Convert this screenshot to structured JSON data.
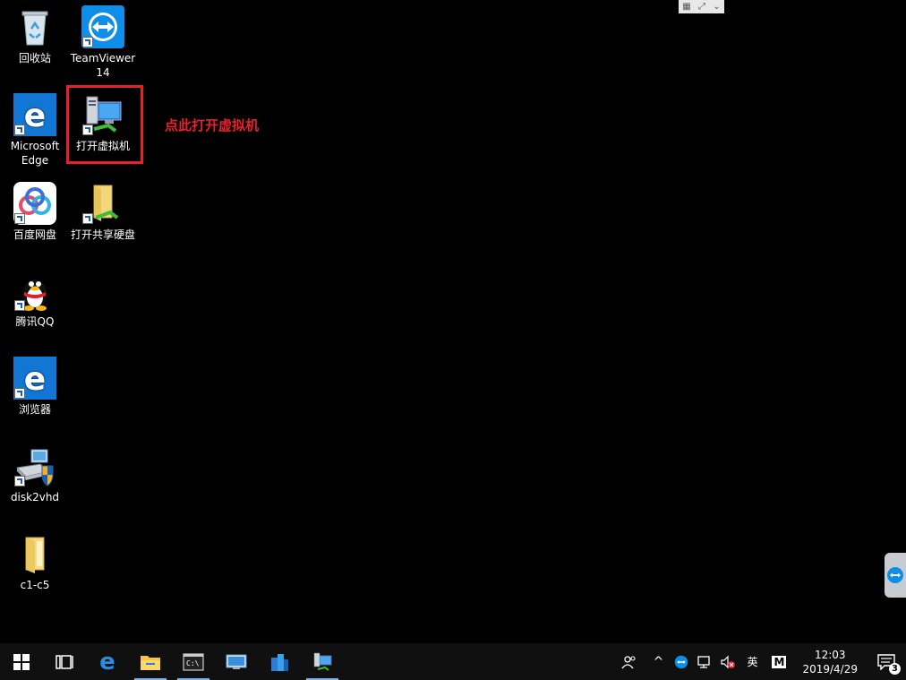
{
  "desktop": {
    "icons": [
      {
        "label": "回收站",
        "icon": "recycle-bin-icon"
      },
      {
        "label": "TeamViewer 14",
        "icon": "teamviewer-icon"
      },
      {
        "label": "Microsoft Edge",
        "icon": "edge-icon"
      },
      {
        "label": "打开虚拟机",
        "icon": "virtual-machine-icon"
      },
      {
        "label": "百度网盘",
        "icon": "baidu-netdisk-icon"
      },
      {
        "label": "打开共享硬盘",
        "icon": "shared-drive-icon"
      },
      {
        "label": "腾讯QQ",
        "icon": "qq-penguin-icon"
      },
      {
        "label": "浏览器",
        "icon": "browser-icon"
      },
      {
        "label": "disk2vhd",
        "icon": "disk2vhd-icon"
      },
      {
        "label": "c1-c5",
        "icon": "folder-icon"
      }
    ],
    "annotation": "点此打开虚拟机"
  },
  "taskbar": {
    "tray_lang": "英",
    "tray_ime": "M",
    "time": "12:03",
    "date": "2019/4/29",
    "notification_count": "3"
  },
  "colors": {
    "highlight": "#e8202a",
    "taskbar": "#101010"
  }
}
